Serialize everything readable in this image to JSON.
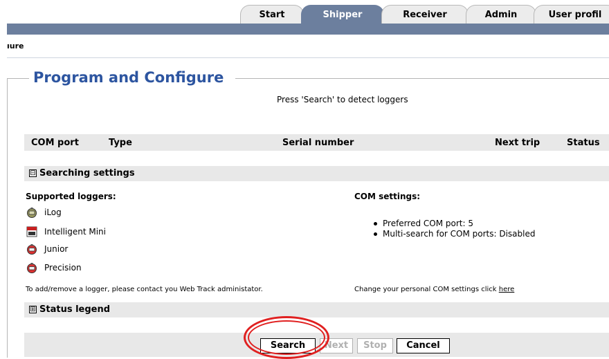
{
  "tabs": [
    {
      "label": "Start",
      "active": false
    },
    {
      "label": "Shipper",
      "active": true
    },
    {
      "label": "Receiver",
      "active": false
    },
    {
      "label": "Admin",
      "active": false
    },
    {
      "label": "User profil",
      "active": false
    }
  ],
  "breadcrumb": "ıure",
  "page_title": "Program and Configure",
  "hint": "Press 'Search' to detect loggers",
  "table": {
    "columns": [
      "COM port",
      "Type",
      "Serial number",
      "Next trip",
      "Status"
    ]
  },
  "searching_settings": {
    "toggle": "⊟",
    "label": "Searching settings",
    "supported_title": "Supported loggers:",
    "loggers": [
      {
        "name": "iLog",
        "icon": "ilog-icon"
      },
      {
        "name": "Intelligent Mini",
        "icon": "mini-icon"
      },
      {
        "name": "Junior",
        "icon": "junior-icon"
      },
      {
        "name": "Precision",
        "icon": "precision-icon"
      }
    ],
    "com_title": "COM settings:",
    "com_items": [
      "Preferred COM port: 5",
      "Multi-search for COM ports: Disabled"
    ],
    "add_note": "To add/remove a logger, please contact you Web Track administator.",
    "change_note": "Change your personal COM settings click ",
    "change_link": "here"
  },
  "status_legend": {
    "toggle": "⊞",
    "label": "Status legend"
  },
  "buttons": {
    "search": "Search",
    "next": "Next",
    "stop": "Stop",
    "cancel": "Cancel"
  },
  "colors": {
    "accent": "#6c7f9e",
    "title": "#2d55a0",
    "highlight": "#e02020"
  }
}
